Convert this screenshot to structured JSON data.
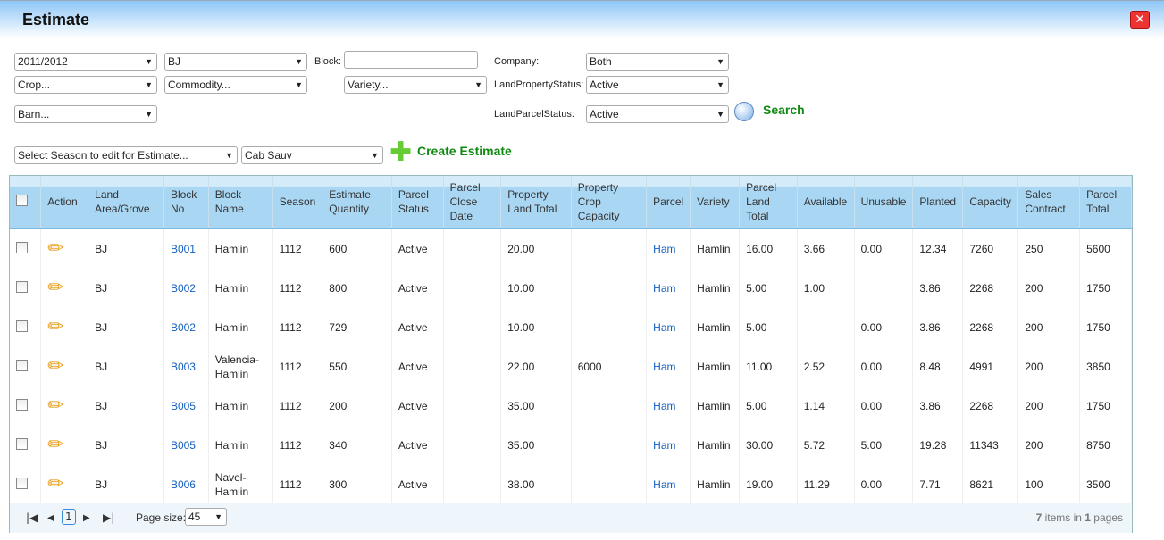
{
  "window": {
    "title": "Estimate",
    "close_icon": "close-icon"
  },
  "filters": {
    "season": "2011/2012",
    "area": "BJ",
    "block_label": "Block:",
    "block_value": "",
    "company_label": "Company:",
    "company": "Both",
    "crop": "Crop...",
    "commodity": "Commodity...",
    "variety": "Variety...",
    "land_property_status_label": "LandPropertyStatus:",
    "land_property_status": "Active",
    "barn": "Barn...",
    "land_parcel_status_label": "LandParcelStatus:",
    "land_parcel_status": "Active",
    "search_label": "Search",
    "edit_season": "Select Season to edit for Estimate...",
    "edit_variety": "Cab Sauv",
    "create_label": "Create Estimate"
  },
  "table": {
    "headers": [
      "",
      "Action",
      "Land Area/Grove",
      "Block No",
      "Block Name",
      "Season",
      "Estimate Quantity",
      "Parcel Status",
      "Parcel Close Date",
      "Property Land Total",
      "Property Crop Capacity",
      "Parcel",
      "Variety",
      "Parcel Land Total",
      "Available",
      "Unusable",
      "Planted",
      "Capacity",
      "Sales Contract",
      "Parcel Total"
    ],
    "rows": [
      [
        "BJ",
        "B001",
        "Hamlin",
        "1112",
        "600",
        "Active",
        "",
        "20.00",
        "",
        "Ham",
        "Hamlin",
        "16.00",
        "3.66",
        "0.00",
        "12.34",
        "7260",
        "250",
        "5600"
      ],
      [
        "BJ",
        "B002",
        "Hamlin",
        "1112",
        "800",
        "Active",
        "",
        "10.00",
        "",
        "Ham",
        "Hamlin",
        "5.00",
        "1.00",
        "",
        "3.86",
        "2268",
        "200",
        "1750"
      ],
      [
        "BJ",
        "B002",
        "Hamlin",
        "1112",
        "729",
        "Active",
        "",
        "10.00",
        "",
        "Ham",
        "Hamlin",
        "5.00",
        "",
        "0.00",
        "3.86",
        "2268",
        "200",
        "1750"
      ],
      [
        "BJ",
        "B003",
        "Valencia-Hamlin",
        "1112",
        "550",
        "Active",
        "",
        "22.00",
        "6000",
        "Ham",
        "Hamlin",
        "11.00",
        "2.52",
        "0.00",
        "8.48",
        "4991",
        "200",
        "3850"
      ],
      [
        "BJ",
        "B005",
        "Hamlin",
        "1112",
        "200",
        "Active",
        "",
        "35.00",
        "",
        "Ham",
        "Hamlin",
        "5.00",
        "1.14",
        "0.00",
        "3.86",
        "2268",
        "200",
        "1750"
      ],
      [
        "BJ",
        "B005",
        "Hamlin",
        "1112",
        "340",
        "Active",
        "",
        "35.00",
        "",
        "Ham",
        "Hamlin",
        "30.00",
        "5.72",
        "5.00",
        "19.28",
        "11343",
        "200",
        "8750"
      ],
      [
        "BJ",
        "B006",
        "Navel-Hamlin",
        "1112",
        "300",
        "Active",
        "",
        "38.00",
        "",
        "Ham",
        "Hamlin",
        "19.00",
        "11.29",
        "0.00",
        "7.71",
        "8621",
        "100",
        "3500"
      ]
    ]
  },
  "pager": {
    "current_page": "1",
    "page_size_label": "Page size:",
    "page_size": "45",
    "summary_count": "7",
    "summary_mid": " items in ",
    "summary_pages": "1",
    "summary_end": " pages"
  }
}
